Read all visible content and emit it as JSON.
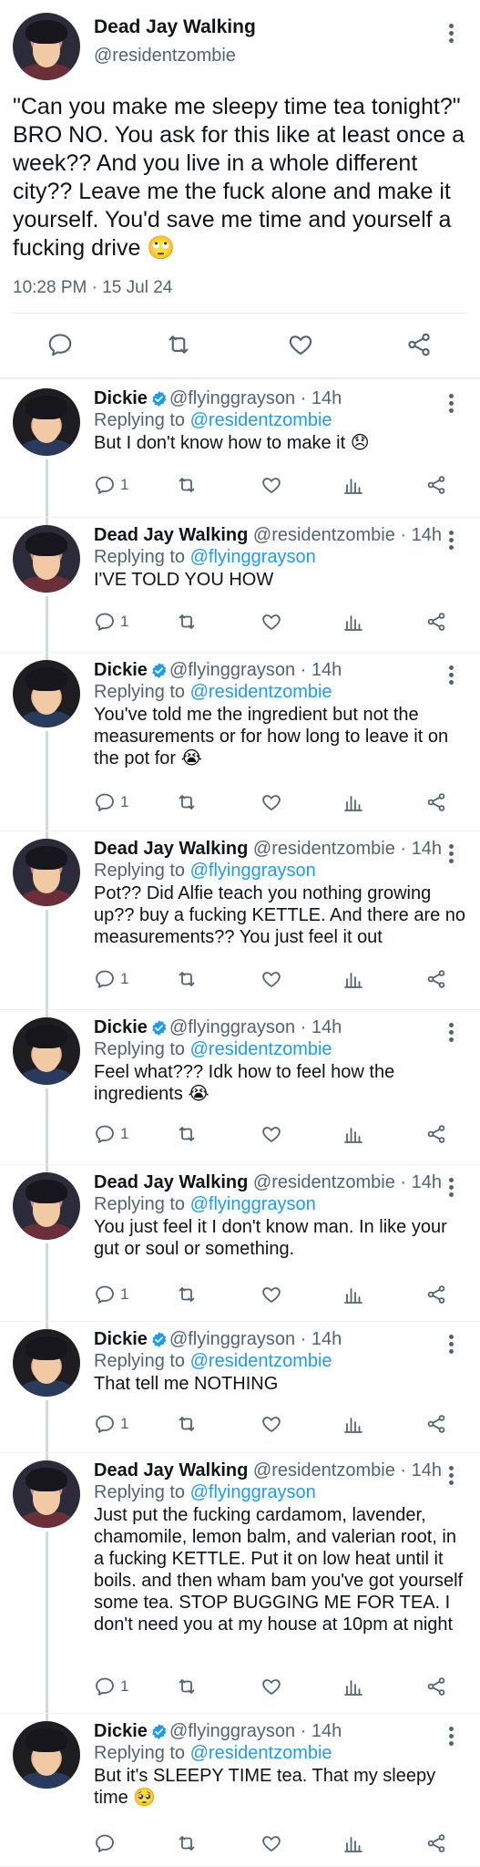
{
  "main_tweet": {
    "author_name": "Dead Jay Walking",
    "author_handle": "@residentzombie",
    "avatar": "dead-jay-walking-avatar",
    "text": "\"Can you make me sleepy time tea tonight?\" BRO NO. You ask for this like at least once a week?? And you live in a whole different city?? Leave me the fuck alone and make it yourself. You'd save me time and yourself a fucking drive 🙄",
    "timestamp": "10:28 PM · 15 Jul 24",
    "actions": [
      "reply-icon",
      "retweet-icon",
      "like-icon",
      "share-icon"
    ]
  },
  "replies": [
    {
      "author_name": "Dickie",
      "verified": true,
      "author_handle": "@flyinggrayson",
      "age": "· 14h",
      "replying_label": "Replying to",
      "replying_to": "@residentzombie",
      "text": "But I don't know how to make it 😞",
      "reply_count": "1"
    },
    {
      "author_name": "Dead Jay Walking",
      "verified": false,
      "author_handle": "@residentzombie",
      "age": "· 14h",
      "replying_label": "Replying to",
      "replying_to": "@flyinggrayson",
      "text": "I'VE TOLD YOU HOW",
      "reply_count": "1"
    },
    {
      "author_name": "Dickie",
      "verified": true,
      "author_handle": "@flyinggrayson",
      "age": "· 14h",
      "replying_label": "Replying to",
      "replying_to": "@residentzombie",
      "text": "You've told me the ingredient but not the measurements or for how long to leave it on the pot for 😭",
      "reply_count": "1"
    },
    {
      "author_name": "Dead Jay Walking",
      "verified": false,
      "author_handle": "@residentzombie",
      "age": "· 14h",
      "replying_label": "Replying to",
      "replying_to": "@flyinggrayson",
      "text": "Pot?? Did Alfie teach you nothing growing up?? buy a fucking KETTLE. And there are no measurements?? You just feel it out",
      "reply_count": "1"
    },
    {
      "author_name": "Dickie",
      "verified": true,
      "author_handle": "@flyinggrayson",
      "age": "· 14h",
      "replying_label": "Replying to",
      "replying_to": "@residentzombie",
      "text": "Feel what??? Idk how to feel how the ingredients 😭",
      "reply_count": "1"
    },
    {
      "author_name": "Dead Jay Walking",
      "verified": false,
      "author_handle": "@residentzombie",
      "age": "· 14h",
      "replying_label": "Replying to",
      "replying_to": "@flyinggrayson",
      "text": "You just feel it I don't know man. In like your gut or soul or something.",
      "reply_count": "1"
    },
    {
      "author_name": "Dickie",
      "verified": true,
      "author_handle": "@flyinggrayson",
      "age": "· 14h",
      "replying_label": "Replying to",
      "replying_to": "@residentzombie",
      "text": "That tell me NOTHING",
      "reply_count": "1"
    },
    {
      "author_name": "Dead Jay Walking",
      "verified": false,
      "author_handle": "@residentzombie",
      "age": "· 14h",
      "replying_label": "Replying to",
      "replying_to": "@flyinggrayson",
      "text": "Just put the fucking cardamom, lavender, chamomile, lemon balm, and valerian root, in a fucking KETTLE. Put it on low heat until it boils. and then wham bam you've got yourself some tea. STOP BUGGING ME FOR TEA. I don't need you at my house at 10pm at night",
      "reply_count": "1"
    },
    {
      "author_name": "Dickie",
      "verified": true,
      "author_handle": "@flyinggrayson",
      "age": "· 14h",
      "replying_label": "Replying to",
      "replying_to": "@residentzombie",
      "text": "But it's SLEEPY TIME tea. That my sleepy time 🥺",
      "reply_count": ""
    }
  ],
  "colors": {
    "text": "#0f1419",
    "secondary": "#536471",
    "link": "#1d9bf0",
    "divider": "#eff3f4",
    "verified": "#1d9bf0"
  }
}
